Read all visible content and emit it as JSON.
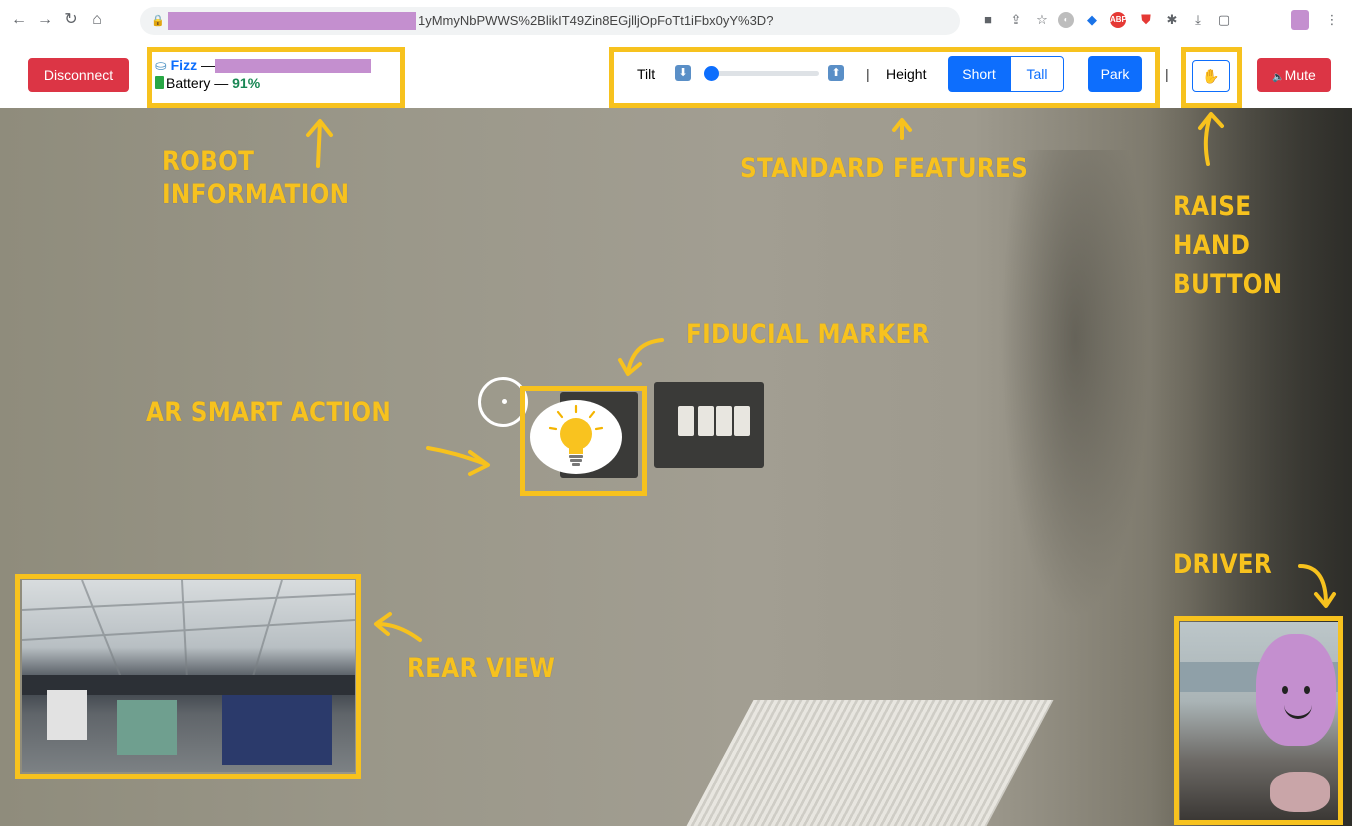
{
  "browser": {
    "url_visible": "1yMmyNbPWWS%2BlikIT49Zin8EGjlljOpFoTt1iFbx0yY%3D?",
    "icons": [
      "back-icon",
      "forward-icon",
      "reload-icon",
      "home-icon",
      "lock-icon",
      "camera-icon",
      "share-icon",
      "star-icon",
      "extension-icons",
      "download-icon",
      "sidepanel-icon",
      "menu-icon"
    ]
  },
  "toolbar": {
    "disconnect_label": "Disconnect",
    "robot_name": "Fizz",
    "name_separator": "—",
    "battery_label": "Battery",
    "battery_separator": "—",
    "battery_value": "91%",
    "tilt_label": "Tilt",
    "tilt_value": 0.05,
    "separator": "|",
    "height_label": "Height",
    "short_label": "Short",
    "tall_label": "Tall",
    "park_label": "Park",
    "raise_hand_glyph": "✋",
    "mute_label": "Mute",
    "mute_glyph": "🔈"
  },
  "annotations": {
    "robot_information": [
      "ROBOT",
      "INFORMATION"
    ],
    "standard_features": "STANDARD FEATURES",
    "raise_hand_button": [
      "RAISE",
      "HAND",
      "BUTTON"
    ],
    "fiducial_marker": "FIDUCIAL MARKER",
    "ar_smart_action": "AR SMART ACTION",
    "rear_view": "REAR VIEW",
    "driver": "DRIVER",
    "color": "#f7c21e"
  },
  "colors": {
    "danger": "#dc3545",
    "primary": "#0d6efd",
    "success": "#198754",
    "redaction": "#c48fcf"
  }
}
